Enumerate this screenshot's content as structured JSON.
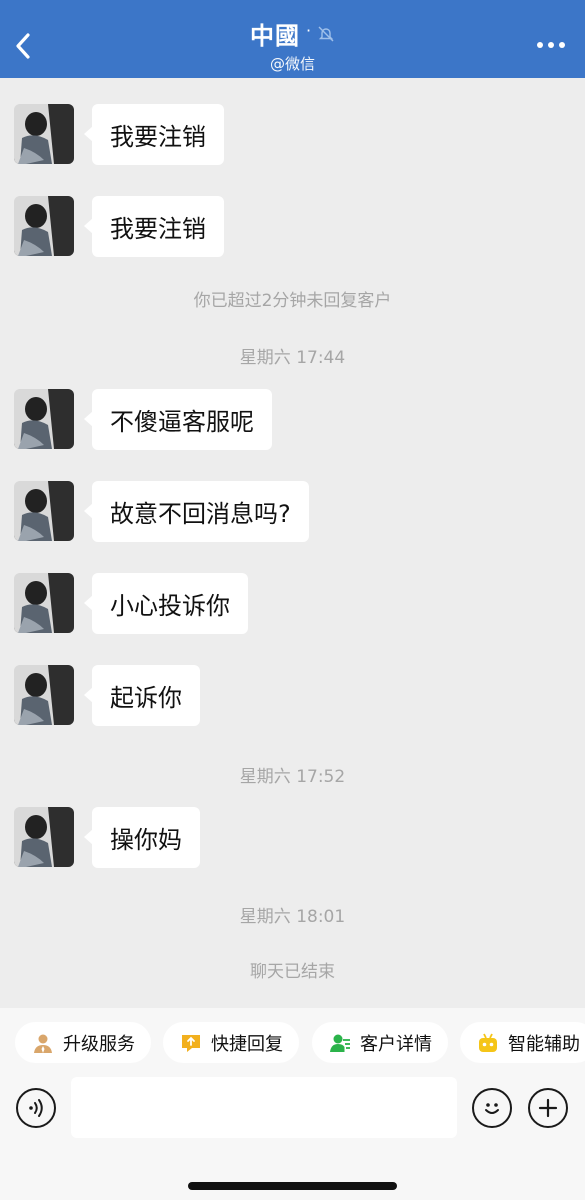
{
  "header": {
    "title": "中國",
    "title_dot": "·",
    "subtitle": "@微信"
  },
  "messages": [
    {
      "text": "我要注销"
    },
    {
      "text": "我要注销"
    },
    {
      "text": "不傻逼客服呢"
    },
    {
      "text": "故意不回消息吗?"
    },
    {
      "text": "小心投诉你"
    },
    {
      "text": "起诉你"
    },
    {
      "text": "操你妈"
    }
  ],
  "system": {
    "timeout_notice": "你已超过2分钟未回复客户",
    "time1": "星期六 17:44",
    "time2": "星期六 17:52",
    "time3": "星期六 18:01",
    "ended": "聊天已结束"
  },
  "quick_actions": [
    {
      "label": "升级服务",
      "icon": "person-upgrade-icon"
    },
    {
      "label": "快捷回复",
      "icon": "quick-reply-icon"
    },
    {
      "label": "客户详情",
      "icon": "customer-detail-icon"
    },
    {
      "label": "智能辅助",
      "icon": "robot-icon"
    }
  ],
  "input": {
    "placeholder": ""
  },
  "colors": {
    "header_bg": "#3c76c8",
    "chat_bg": "#ededed",
    "quick_upgrade_icon": "#d9a66b",
    "quick_reply_icon": "#f2b01e",
    "customer_icon": "#2bb34a",
    "robot_icon": "#f5c518"
  }
}
